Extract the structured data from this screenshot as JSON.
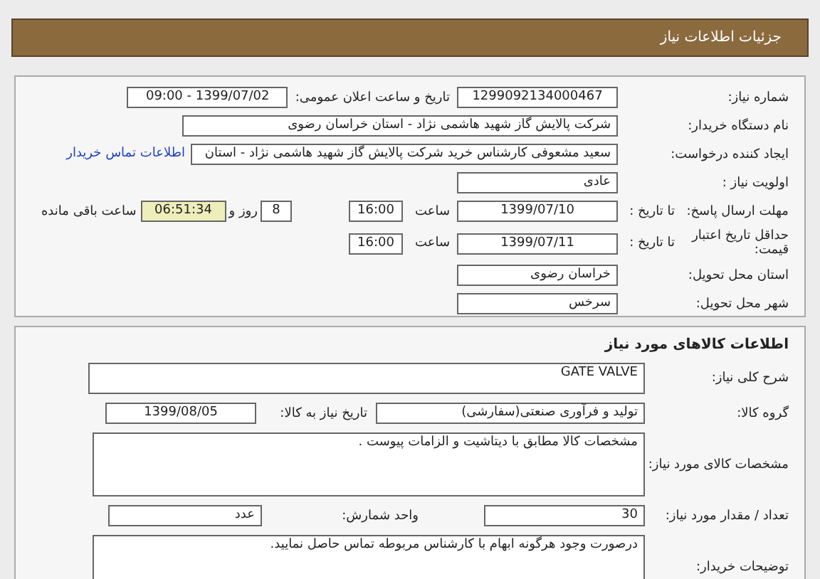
{
  "header": {
    "title": "جزئیات اطلاعات نیاز"
  },
  "general": {
    "need_number_label": "شماره نیاز:",
    "need_number": "1299092134000467",
    "announce_label": "تاریخ و ساعت اعلان عمومی:",
    "announce": "1399/07/02 - 09:00",
    "buyer_label": "نام دستگاه خریدار:",
    "buyer": "شرکت پالایش گاز شهید هاشمی نژاد - استان خراسان رضوی",
    "creator_label": "ایجاد کننده درخواست:",
    "creator": "سعید مشعوفی کارشناس خرید شرکت پالایش گاز شهید هاشمی نژاد - استان",
    "contact_link": "اطلاعات تماس خریدار",
    "priority_label": "اولویت نیاز :",
    "priority": "عادی",
    "deadline_label": "مهلت ارسال پاسخ:",
    "deadline_to_label": "تا تاریخ :",
    "deadline_date": "1399/07/10",
    "deadline_time_label": "ساعت",
    "deadline_time": "16:00",
    "days": "8",
    "days_label": "روز و",
    "remaining": "06:51:34",
    "remaining_label": "ساعت باقی مانده",
    "validity_label": "حداقل تاریخ اعتبار قیمت:",
    "validity_to_label": "تا تاریخ :",
    "validity_date": "1399/07/11",
    "validity_time_label": "ساعت",
    "validity_time": "16:00",
    "province_label": "استان محل تحویل:",
    "province": "خراسان رضوی",
    "city_label": "شهر محل تحویل:",
    "city": "سرخس"
  },
  "goods": {
    "title": "اطلاعات کالاهای مورد نیاز",
    "description_label": "شرح کلی نیاز:",
    "description": "GATE VALVE",
    "group_label": "گروه کالا:",
    "group": "تولید و فرآوری صنعتی(سفارشی)",
    "need_date_label": "تاریخ نیاز به کالا:",
    "need_date": "1399/08/05",
    "specs_label": "مشخصات کالای مورد نیاز:",
    "specs": "مشخصات کالا مطابق با دیتاشیت و الزامات پیوست .",
    "quantity_label": "تعداد / مقدار مورد نیاز:",
    "quantity": "30",
    "unit_label": "واحد شمارش:",
    "unit": "عدد",
    "notes_label": "توضیحات خریدار:",
    "notes": "درصورت وجود هرگونه ابهام با کارشناس مربوطه تماس حاصل نمایید."
  }
}
